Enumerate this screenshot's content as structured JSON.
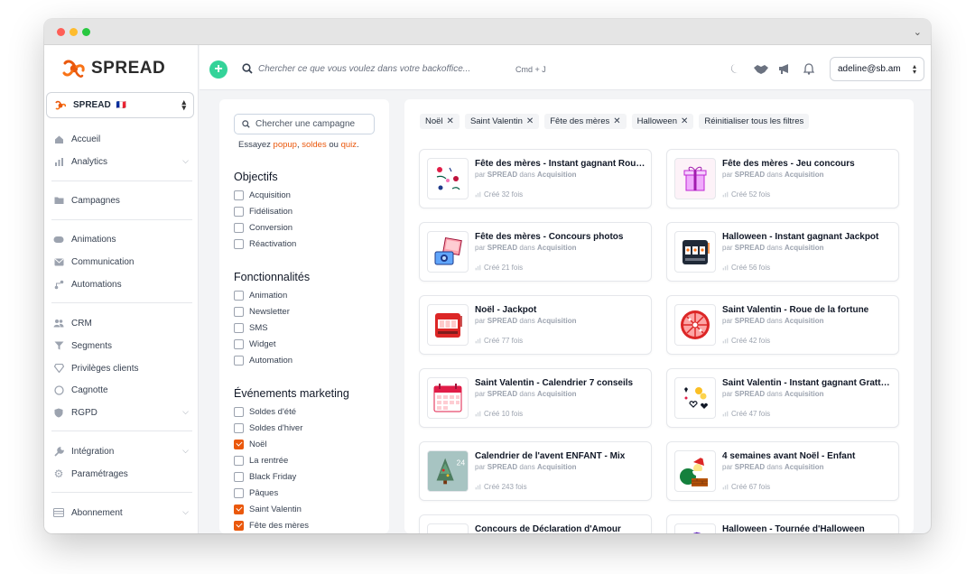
{
  "brand": {
    "name": "SPREAD",
    "accent": "#ea580c",
    "green": "#34d399"
  },
  "account": {
    "name": "SPREAD",
    "flag": "🇫🇷"
  },
  "sidebar": {
    "items": [
      {
        "label": "Accueil",
        "icon": "home-icon"
      },
      {
        "label": "Analytics",
        "icon": "chart-icon"
      },
      {
        "label": "Campagnes",
        "icon": "folder-icon"
      },
      {
        "label": "Animations",
        "icon": "gamepad-icon"
      },
      {
        "label": "Communication",
        "icon": "mail-icon"
      },
      {
        "label": "Automations",
        "icon": "flow-icon"
      },
      {
        "label": "CRM",
        "icon": "users-icon"
      },
      {
        "label": "Segments",
        "icon": "filter-icon"
      },
      {
        "label": "Privilèges clients",
        "icon": "diamond-icon"
      },
      {
        "label": "Cagnotte",
        "icon": "coin-icon"
      },
      {
        "label": "RGPD",
        "icon": "shield-icon"
      },
      {
        "label": "Intégration",
        "icon": "wrench-icon"
      },
      {
        "label": "Paramétrages",
        "icon": "gear-icon"
      },
      {
        "label": "Abonnement",
        "icon": "card-icon"
      }
    ]
  },
  "topbar": {
    "search_placeholder": "Chercher ce que vous voulez dans votre backoffice...",
    "shortcut": "Cmd + J",
    "user": "adeline@sb.am"
  },
  "filters": {
    "search_placeholder": "Chercher une campagne",
    "try_prefix": "Essayez",
    "try_links": [
      "popup",
      "soldes",
      "quiz"
    ],
    "try_sep1": ",",
    "try_sep2": "ou",
    "try_end": ".",
    "groups": [
      {
        "title": "Objectifs",
        "options": [
          {
            "label": "Acquisition",
            "checked": false
          },
          {
            "label": "Fidélisation",
            "checked": false
          },
          {
            "label": "Conversion",
            "checked": false
          },
          {
            "label": "Réactivation",
            "checked": false
          }
        ]
      },
      {
        "title": "Fonctionnalités",
        "options": [
          {
            "label": "Animation",
            "checked": false
          },
          {
            "label": "Newsletter",
            "checked": false
          },
          {
            "label": "SMS",
            "checked": false
          },
          {
            "label": "Widget",
            "checked": false
          },
          {
            "label": "Automation",
            "checked": false
          }
        ]
      },
      {
        "title": "Événements marketing",
        "options": [
          {
            "label": "Soldes d'été",
            "checked": false
          },
          {
            "label": "Soldes d'hiver",
            "checked": false
          },
          {
            "label": "Noël",
            "checked": true
          },
          {
            "label": "La rentrée",
            "checked": false
          },
          {
            "label": "Black Friday",
            "checked": false
          },
          {
            "label": "Pâques",
            "checked": false
          },
          {
            "label": "Saint Valentin",
            "checked": true
          },
          {
            "label": "Fête des mères",
            "checked": true
          }
        ]
      }
    ]
  },
  "active_filters": [
    "Noël",
    "Saint Valentin",
    "Fête des mères",
    "Halloween"
  ],
  "reset_label": "Réinitialiser tous les filtres",
  "meta": {
    "by": "par",
    "owner": "SPREAD",
    "in": "dans",
    "category": "Acquisition"
  },
  "campaigns": [
    {
      "title": "Fête des mères - Instant gagnant Roulette",
      "uses": "Créé 32 fois",
      "thumb": "flowers"
    },
    {
      "title": "Fête des mères - Jeu concours",
      "uses": "Créé 52 fois",
      "thumb": "gift"
    },
    {
      "title": "Fête des mères - Concours photos",
      "uses": "Créé 21 fois",
      "thumb": "camera"
    },
    {
      "title": "Halloween - Instant gagnant Jackpot",
      "uses": "Créé 56 fois",
      "thumb": "jackpot-dark"
    },
    {
      "title": "Noël - Jackpot",
      "uses": "Créé 77 fois",
      "thumb": "jackpot-red"
    },
    {
      "title": "Saint Valentin - Roue de la fortune",
      "uses": "Créé 42 fois",
      "thumb": "wheel"
    },
    {
      "title": "Saint Valentin - Calendrier 7 conseils",
      "uses": "Créé 10 fois",
      "thumb": "calendar"
    },
    {
      "title": "Saint Valentin - Instant gagnant Grattage",
      "uses": "Créé 47 fois",
      "thumb": "scratch"
    },
    {
      "title": "Calendrier de l'avent ENFANT - Mix",
      "uses": "Créé 243 fois",
      "thumb": "tree"
    },
    {
      "title": "4 semaines avant Noël - Enfant",
      "uses": "Créé 67 fois",
      "thumb": "santa"
    },
    {
      "title": "Concours de Déclaration d'Amour",
      "uses": "",
      "thumb": "heart"
    },
    {
      "title": "Halloween - Tournée d'Halloween",
      "uses": "",
      "thumb": "witch"
    }
  ]
}
